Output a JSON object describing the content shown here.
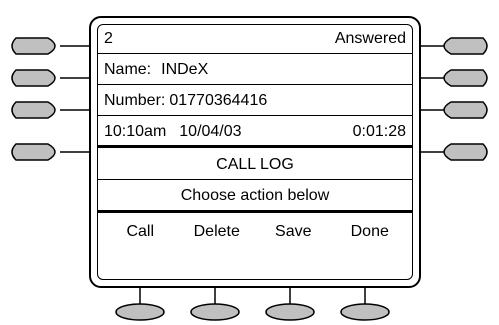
{
  "status": {
    "line": "2",
    "state": "Answered"
  },
  "caller": {
    "name_label": "Name:",
    "name_value": "INDeX",
    "number_label": "Number:",
    "number_value": "01770364416"
  },
  "call_info": {
    "time": "10:10am",
    "date": "10/04/03",
    "duration": "0:01:28"
  },
  "heading": "CALL LOG",
  "prompt": "Choose action below",
  "softkeys": [
    "Call",
    "Delete",
    "Save",
    "Done"
  ],
  "colors": {
    "button_fill": "#c0c0c0",
    "outline": "#000000",
    "background": "#ffffff"
  }
}
